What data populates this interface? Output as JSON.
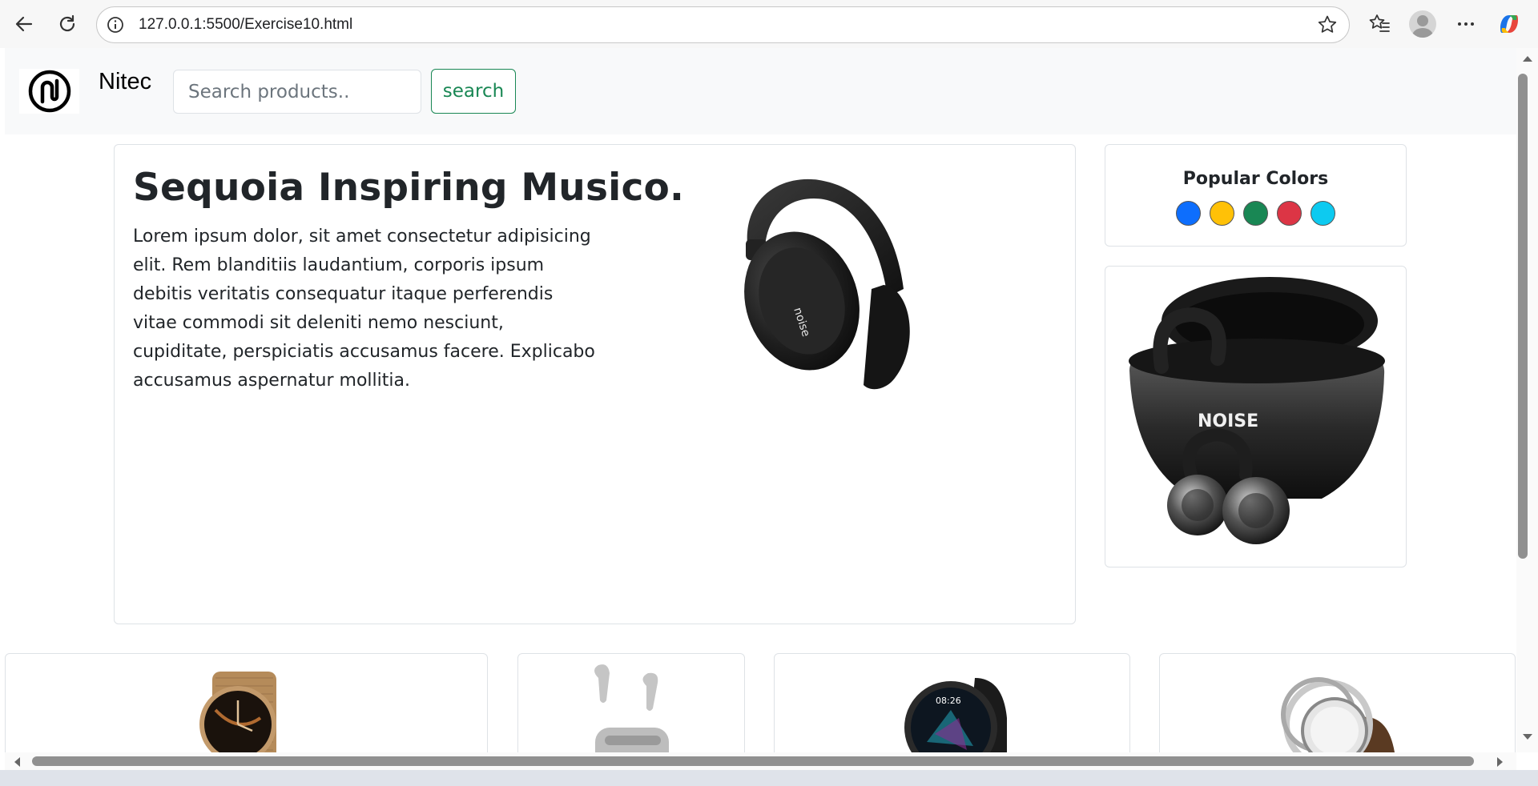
{
  "browser": {
    "url": "127.0.0.1:5500/Exercise10.html"
  },
  "navbar": {
    "brand": "Nitec",
    "search_placeholder": "Search products..",
    "search_button": "search"
  },
  "hero": {
    "title": "Sequoia Inspiring Musico.",
    "text": "Lorem ipsum dolor, sit amet consectetur adipisicing elit. Rem blanditiis laudantium, corporis ipsum debitis veritatis consequatur itaque perferendis vitae commodi sit deleniti nemo nesciunt, cupiditate, perspiciatis accusamus facere. Explicabo accusamus aspernatur mollitia.",
    "product_logo": "noise"
  },
  "popular_colors": {
    "title": "Popular Colors",
    "swatches": [
      "#0d6efd",
      "#ffc107",
      "#198754",
      "#dc3545",
      "#0dcaf0"
    ]
  },
  "earbuds_card": {
    "product_logo": "NOISE"
  },
  "products": [
    {
      "name": "gold-smartwatch"
    },
    {
      "name": "silver-earbuds"
    },
    {
      "name": "black-smartwatch",
      "watch_time": "08:26"
    },
    {
      "name": "steel-smartwatch"
    }
  ]
}
